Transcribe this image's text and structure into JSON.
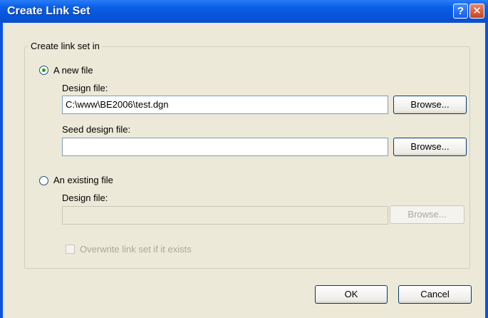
{
  "window": {
    "title": "Create Link Set",
    "help_glyph": "?",
    "close_glyph": "✕"
  },
  "group": {
    "legend": "Create link set in",
    "new_file": {
      "radio_label": "A new file",
      "checked": true,
      "design_label": "Design file:",
      "design_value": "C:\\www\\BE2006\\test.dgn",
      "design_browse": "Browse...",
      "seed_label": "Seed design file:",
      "seed_value": "",
      "seed_browse": "Browse..."
    },
    "existing_file": {
      "radio_label": "An existing file",
      "checked": false,
      "design_label": "Design file:",
      "design_value": "",
      "design_browse": "Browse..."
    },
    "overwrite_label": "Overwrite link set if it exists"
  },
  "buttons": {
    "ok": "OK",
    "cancel": "Cancel"
  }
}
